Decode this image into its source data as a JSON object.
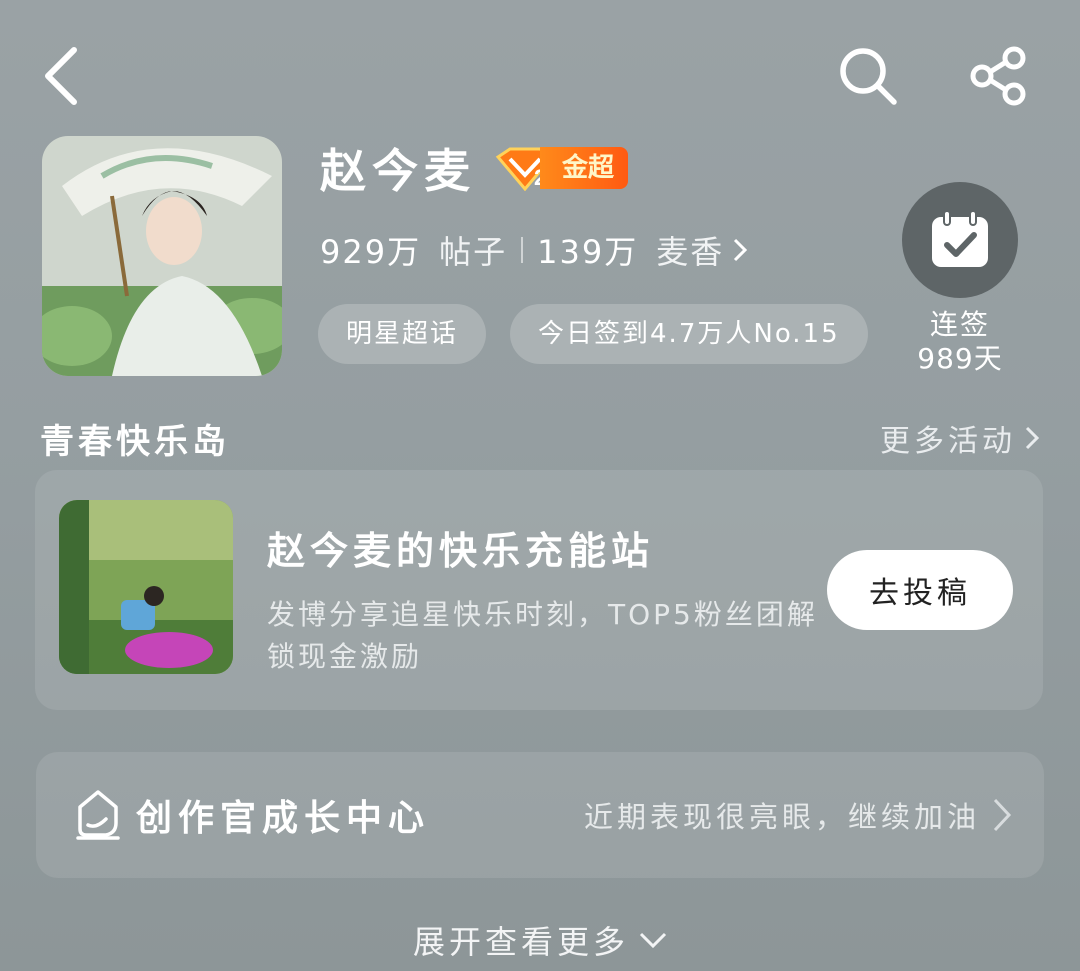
{
  "topbar": {
    "back_icon": "chevron-left-icon",
    "search_icon": "search-icon",
    "share_icon": "share-icon"
  },
  "profile": {
    "name": "赵今麦",
    "badge": {
      "icon": "diamond-level-icon",
      "level": "2",
      "label": "金超"
    },
    "posts_count": "929万",
    "posts_label": "帖子",
    "fans_count": "139万",
    "fans_label": "麦香",
    "tags": [
      "明星超话",
      "今日签到4.7万人No.15"
    ],
    "checkin": {
      "label": "连签",
      "days": "989天",
      "icon": "calendar-check-icon"
    }
  },
  "section": {
    "title": "青春快乐岛",
    "more": "更多活动"
  },
  "activity_card": {
    "title": "赵今麦的快乐充能站",
    "description": "发博分享追星快乐时刻，TOP5粉丝团解锁现金激励",
    "button": "去投稿"
  },
  "growth": {
    "icon": "creator-pen-icon",
    "title": "创作官成长中心",
    "subtitle": "近期表现很亮眼，继续加油"
  },
  "footer": {
    "expand": "展开查看更多",
    "expand_icon": "chevron-down-icon"
  },
  "colors": {
    "badge_orange": "#ff6a14",
    "checkin_bg": "#5e6567",
    "button_bg": "#ffffff"
  }
}
